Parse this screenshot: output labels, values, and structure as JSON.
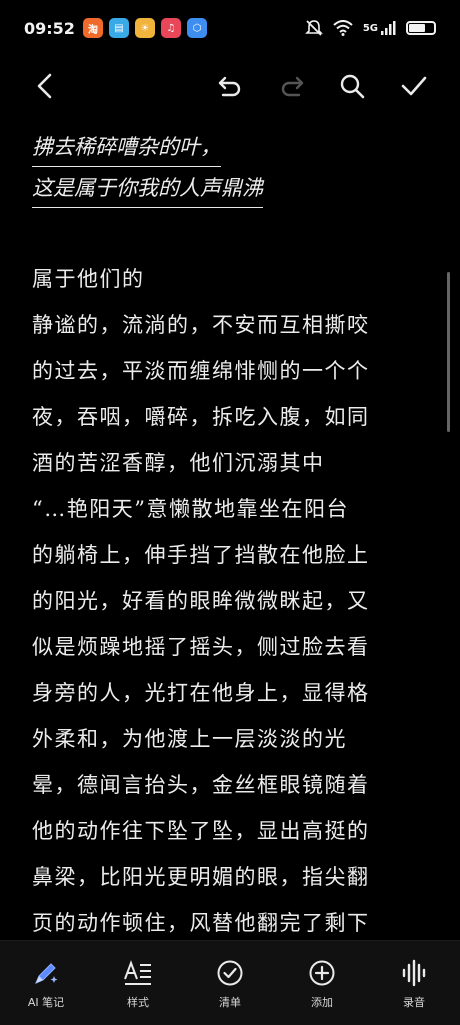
{
  "status_bar": {
    "time": "09:52",
    "network": "5G"
  },
  "toolbar": {
    "back_icon": "chevron-left-icon",
    "undo_icon": "undo-icon",
    "redo_icon": "redo-icon",
    "search_icon": "search-icon",
    "confirm_icon": "check-icon"
  },
  "note": {
    "title_lines": [
      "拂去稀碎嘈杂的叶，",
      "这是属于你我的人声鼎沸"
    ],
    "body_lines": [
      "属于他们的",
      "静谧的，流淌的，不安而互相撕咬",
      "的过去，平淡而缠绵悱恻的一个个",
      "夜，吞咽，嚼碎，拆吃入腹，如同",
      "酒的苦涩香醇，他们沉溺其中",
      "“…艳阳天”意懒散地靠坐在阳台",
      "的躺椅上，伸手挡了挡散在他脸上",
      "的阳光，好看的眼眸微微眯起，又",
      "似是烦躁地摇了摇头，侧过脸去看",
      "身旁的人，光打在他身上，显得格",
      "外柔和，为他渡上一层淡淡的光",
      "晕，德闻言抬头，金丝框眼镜随着",
      "他的动作往下坠了坠，显出高挺的",
      "鼻梁，比阳光更明媚的眼，指尖翻",
      "页的动作顿住，风替他翻完了剩下"
    ]
  },
  "bottom_nav": [
    {
      "label": "AI 笔记",
      "icon": "ai-pen-icon"
    },
    {
      "label": "样式",
      "icon": "text-style-icon"
    },
    {
      "label": "清单",
      "icon": "checklist-icon"
    },
    {
      "label": "添加",
      "icon": "add-circle-icon"
    },
    {
      "label": "录音",
      "icon": "audio-wave-icon"
    }
  ],
  "colors": {
    "background": "#000000",
    "text": "#ececec",
    "bottom_bar": "#111111",
    "ai_icon_accent": "#4a7cff"
  }
}
